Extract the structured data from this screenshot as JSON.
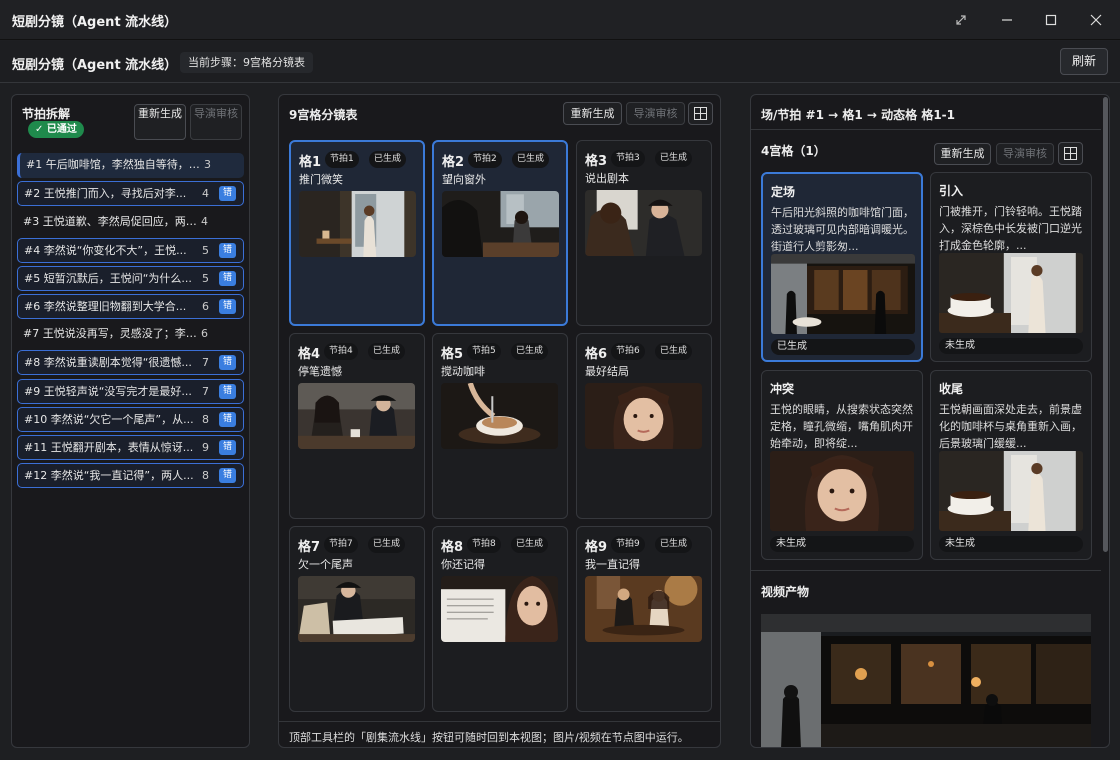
{
  "window": {
    "title": "短剧分镜（Agent 流水线）"
  },
  "header": {
    "title": "短剧分镜（Agent 流水线）",
    "step": "当前步骤：9宫格分镜表",
    "refresh": "刷新"
  },
  "left": {
    "title": "节拍拆解",
    "status": "✓ 已通过",
    "regen": "重新生成",
    "review": "导演审核",
    "beats": [
      {
        "text": "#1  午后咖啡馆，李然独自等待，焦...",
        "count": "3",
        "badge": ""
      },
      {
        "text": "#2  王悦推门而入，寻找后对李...",
        "count": "4",
        "badge": "错"
      },
      {
        "text": "#3  王悦道歉、李然局促回应，两人...",
        "count": "4",
        "badge": ""
      },
      {
        "text": "#4  李然说“你变化不大”，王悦...",
        "count": "5",
        "badge": "错"
      },
      {
        "text": "#5  短暂沉默后，王悦问“为什么...",
        "count": "5",
        "badge": "错"
      },
      {
        "text": "#6  李然说整理旧物翻到大学合...",
        "count": "6",
        "badge": "错"
      },
      {
        "text": "#7  王悦说没再写，灵感没了；李然...",
        "count": "6",
        "badge": ""
      },
      {
        "text": "#8  李然说重读剧本觉得“很遗憾...",
        "count": "7",
        "badge": "错"
      },
      {
        "text": "#9  王悦轻声说“没写完才是最好...",
        "count": "7",
        "badge": "错"
      },
      {
        "text": "#10  李然说“欠它一个尾声”，从...",
        "count": "8",
        "badge": "错"
      },
      {
        "text": "#11  王悦翻开剧本，表情从惊讶...",
        "count": "9",
        "badge": "错"
      },
      {
        "text": "#12  李然说“我一直记得”，两人...",
        "count": "8",
        "badge": "错"
      }
    ]
  },
  "middle": {
    "title": "9宫格分镜表",
    "regen": "重新生成",
    "review": "导演审核",
    "footer": "顶部工具栏的「剧集流水线」按钮可随时回到本视图；图片/视频在节点图中运行。",
    "cells": [
      {
        "g": "格1",
        "beat": "节拍1",
        "status": "已生成",
        "cap": "推门微笑",
        "scene": "door",
        "sel": true
      },
      {
        "g": "格2",
        "beat": "节拍2",
        "status": "已生成",
        "cap": "望向窗外",
        "scene": "window",
        "sel": true
      },
      {
        "g": "格3",
        "beat": "节拍3",
        "status": "已生成",
        "cap": "说出剧本",
        "scene": "talk",
        "sel": false
      },
      {
        "g": "格4",
        "beat": "节拍4",
        "status": "已生成",
        "cap": "停笔遗憾",
        "scene": "pair",
        "sel": false
      },
      {
        "g": "格5",
        "beat": "节拍5",
        "status": "已生成",
        "cap": "搅动咖啡",
        "scene": "cup",
        "sel": false
      },
      {
        "g": "格6",
        "beat": "节拍6",
        "status": "已生成",
        "cap": "最好结局",
        "scene": "face",
        "sel": false
      },
      {
        "g": "格7",
        "beat": "节拍7",
        "status": "已生成",
        "cap": "欠一个尾声",
        "scene": "book",
        "sel": false
      },
      {
        "g": "格8",
        "beat": "节拍8",
        "status": "已生成",
        "cap": "你还记得",
        "scene": "paper",
        "sel": false
      },
      {
        "g": "格9",
        "beat": "节拍9",
        "status": "已生成",
        "cap": "我一直记得",
        "scene": "warm",
        "sel": false
      }
    ]
  },
  "right": {
    "title": "场/节拍 #1 → 格1 → 动态格 格1-1",
    "grid_title": "4宫格（1）",
    "regen": "重新生成",
    "review": "导演审核",
    "cards": [
      {
        "h": "定场",
        "d": "午后阳光斜照的咖啡馆门面，透过玻璃可见内部暗调暖光。街道行人剪影匆...",
        "status": "已生成",
        "scene": "cafe",
        "sel": true
      },
      {
        "h": "引入",
        "d": "门被推开，门铃轻响。王悦踏入，深棕色中长发被门口逆光打成金色轮廓，...",
        "status": "未生成",
        "scene": "cupwin",
        "sel": false
      },
      {
        "h": "冲突",
        "d": "王悦的眼睛，从搜索状态突然定格，瞳孔微缩，嘴角肌肉开始牵动，即将绽...",
        "status": "未生成",
        "scene": "face",
        "sel": false
      },
      {
        "h": "收尾",
        "d": "王悦朝画面深处走去，前景虚化的咖啡杯与桌角重新入画，后景玻璃门缓缓...",
        "status": "未生成",
        "scene": "cupwin",
        "sel": false
      }
    ],
    "video_title": "视频产物"
  }
}
